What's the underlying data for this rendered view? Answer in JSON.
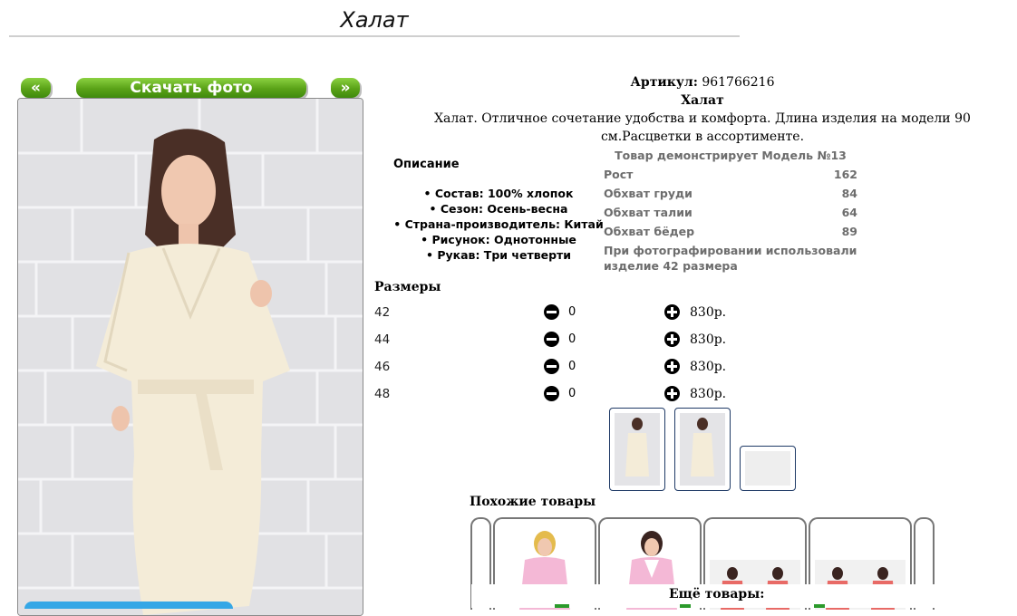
{
  "page": {
    "title": "Халат"
  },
  "gallery": {
    "prev_label": "«",
    "download_label": "Скачать фото",
    "next_label": "»"
  },
  "product": {
    "article_label": "Артикул:",
    "article_value": "961766216",
    "name": "Халат",
    "description": "Халат. Отличное сочетание удобства и комфорта. Длина изделия на модели 90 см.Расцветки в ассортименте."
  },
  "description_block": {
    "heading": "Описание",
    "items": [
      "Состав: 100% хлопок",
      "Сезон: Осень-весна",
      "Страна-производитель: Китай",
      "Рисунок: Однотонные",
      "Рукав: Три четверти"
    ]
  },
  "model": {
    "title": "Товар демонстрирует Модель №13",
    "rows": [
      {
        "label": "Рост",
        "value": "162"
      },
      {
        "label": "Обхват груди",
        "value": "84"
      },
      {
        "label": "Обхват талии",
        "value": "64"
      },
      {
        "label": "Обхват бёдер",
        "value": "89"
      }
    ],
    "note": "При фотографировании использовали изделие 42 размера"
  },
  "sizes": {
    "heading": "Размеры",
    "rows": [
      {
        "size": "42",
        "qty": "0",
        "price": "830р."
      },
      {
        "size": "44",
        "qty": "0",
        "price": "830р."
      },
      {
        "size": "46",
        "qty": "0",
        "price": "830р."
      },
      {
        "size": "48",
        "qty": "0",
        "price": "830р."
      }
    ]
  },
  "similar": {
    "heading": "Похожие товары"
  },
  "more": {
    "heading": "Ещё товары:"
  },
  "colors": {
    "button_green": "#5aa217",
    "robe_cream": "#f4ecd8",
    "thumb_border": "#1f3a66",
    "similar_pink": "#f4b8d6",
    "similar_coral": "#e86a66",
    "accent_blue": "#35a7e6"
  }
}
